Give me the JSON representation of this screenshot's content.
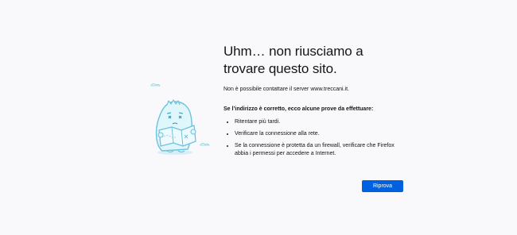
{
  "error": {
    "title": "Uhm… non riusciamo a trovare questo sito.",
    "description": "Non è possibile contattare il server www.treccani.it.",
    "suggestions_heading": "Se l’indirizzo è corretto, ecco alcune prove da effettuare:",
    "suggestions": [
      "Ritentare più tardi.",
      "Verificare la connessione alla rete.",
      "Se la connessione è protetta da un firewall, verificare che Firefox abbia i permessi per accedere a Internet."
    ],
    "retry_label": "Riprova"
  },
  "illustration": {
    "icon": "confused-dino-with-map-illustration"
  },
  "colors": {
    "background": "#f9f9fb",
    "accent": "#0061e0",
    "illustration_fill": "#dff6fb",
    "illustration_stroke": "#6fc2dc"
  }
}
